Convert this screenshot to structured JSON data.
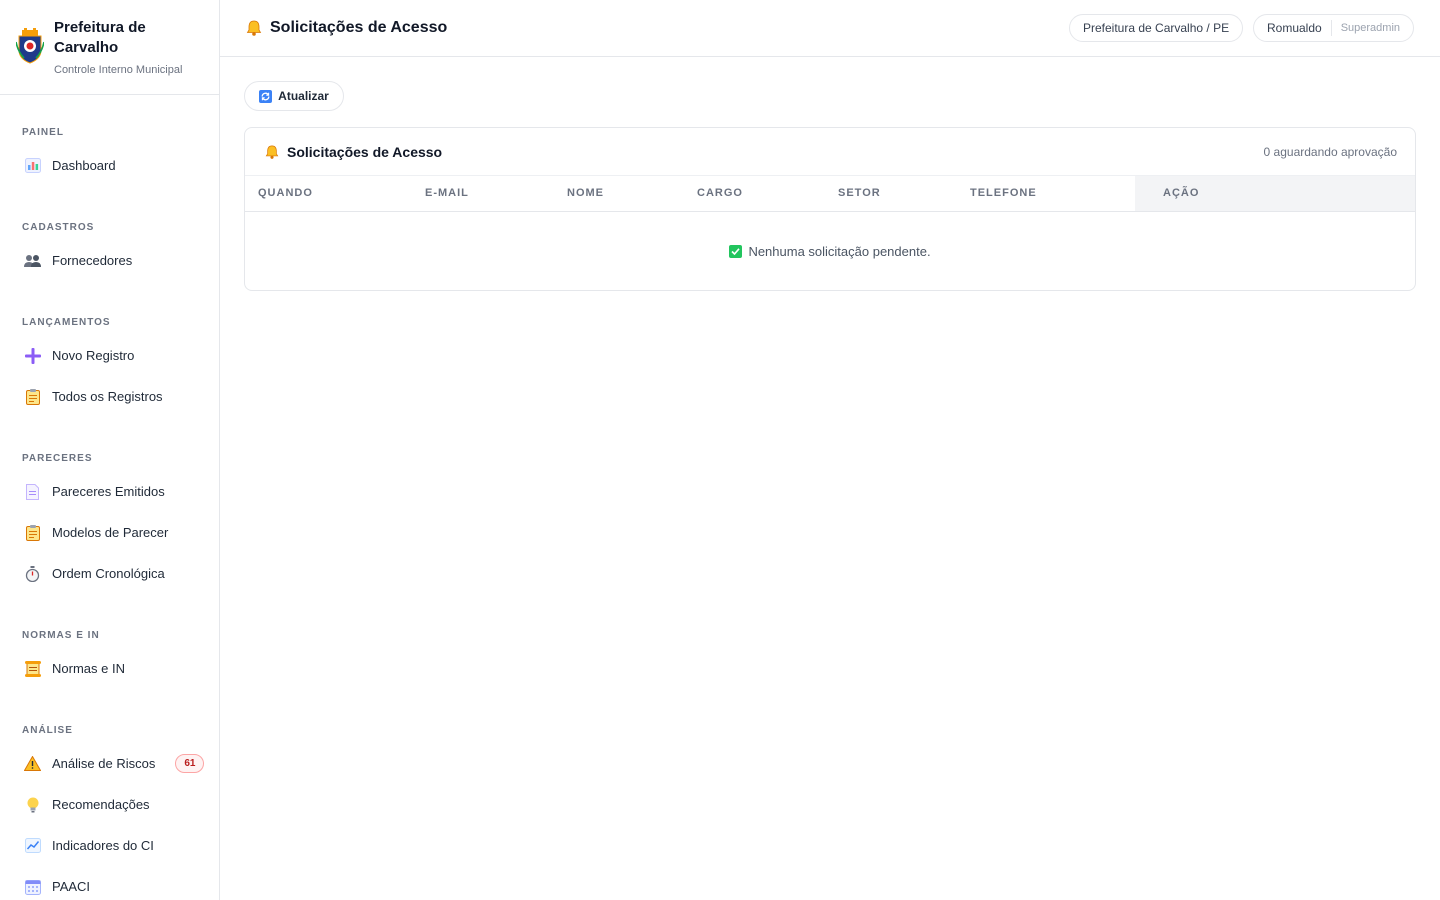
{
  "brand": {
    "title": "Prefeitura de Carvalho",
    "subtitle": "Controle Interno Municipal"
  },
  "sidebar": {
    "sections": [
      {
        "label": "PAINEL",
        "items": [
          {
            "label": "Dashboard",
            "icon": "bar-chart-icon"
          }
        ]
      },
      {
        "label": "CADASTROS",
        "items": [
          {
            "label": "Fornecedores",
            "icon": "users-icon"
          }
        ]
      },
      {
        "label": "LANÇAMENTOS",
        "items": [
          {
            "label": "Novo Registro",
            "icon": "plus-icon"
          },
          {
            "label": "Todos os Registros",
            "icon": "clipboard-icon"
          }
        ]
      },
      {
        "label": "PARECERES",
        "items": [
          {
            "label": "Pareceres Emitidos",
            "icon": "document-icon"
          },
          {
            "label": "Modelos de Parecer",
            "icon": "clipboard-icon"
          },
          {
            "label": "Ordem Cronológica",
            "icon": "stopwatch-icon"
          }
        ]
      },
      {
        "label": "NORMAS E IN",
        "items": [
          {
            "label": "Normas e IN",
            "icon": "scroll-icon"
          }
        ]
      },
      {
        "label": "ANÁLISE",
        "items": [
          {
            "label": "Análise de Riscos",
            "icon": "warning-icon",
            "badge": "61"
          },
          {
            "label": "Recomendações",
            "icon": "lightbulb-icon"
          },
          {
            "label": "Indicadores do CI",
            "icon": "line-chart-icon"
          },
          {
            "label": "PAACI",
            "icon": "calendar-icon"
          }
        ]
      }
    ]
  },
  "header": {
    "title": "Solicitações de Acesso",
    "org": "Prefeitura de Carvalho / PE",
    "user": "Romualdo",
    "role": "Superadmin"
  },
  "toolbar": {
    "refresh_label": "Atualizar"
  },
  "card": {
    "title": "Solicitações de Acesso",
    "count": "0 aguardando aprovação",
    "columns": [
      "QUANDO",
      "E-MAIL",
      "NOME",
      "CARGO",
      "SETOR",
      "TELEFONE",
      "AÇÃO"
    ],
    "empty": "Nenhuma solicitação pendente."
  },
  "colors": {
    "accent_badge": "#b91c1c",
    "success": "#22c55e",
    "border": "#e5e7eb"
  }
}
